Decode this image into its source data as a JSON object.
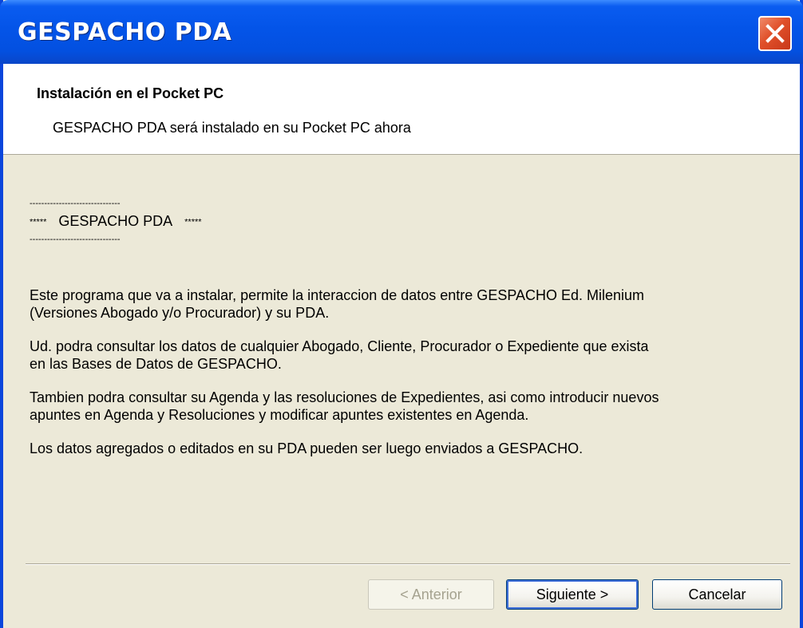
{
  "window": {
    "title": "GESPACHO PDA"
  },
  "header": {
    "title": "Instalación en el Pocket PC",
    "subtitle": "GESPACHO PDA será instalado en su Pocket PC ahora"
  },
  "content": {
    "dash_top": "-------------------------------",
    "banner_left_stars": "*****",
    "banner_text": "GESPACHO PDA",
    "banner_right_stars": "*****",
    "dash_bottom": "-------------------------------",
    "paragraph_1_line_1": "Este programa que va a instalar, permite la interaccion de datos entre GESPACHO Ed. Milenium",
    "paragraph_1_line_2": "(Versiones Abogado y/o Procurador) y su PDA.",
    "paragraph_2_line_1": "Ud. podra consultar los datos de cualquier Abogado, Cliente, Procurador o Expediente que exista",
    "paragraph_2_line_2": "en las Bases de Datos de GESPACHO.",
    "paragraph_3_line_1": "Tambien podra consultar su Agenda y las resoluciones de Expedientes, asi como introducir nuevos",
    "paragraph_3_line_2": "apuntes en Agenda y Resoluciones y modificar apuntes existentes en Agenda.",
    "paragraph_4_line_1": "Los datos agregados o editados en su PDA pueden ser luego enviados a GESPACHO."
  },
  "buttons": {
    "previous": "< Anterior",
    "next": "Siguiente >",
    "cancel": "Cancelar"
  },
  "colors": {
    "titlebar": "#0454e8",
    "window_bg": "#ece9d8",
    "close_button": "#e0502a"
  },
  "icons": {
    "close": "close-icon"
  }
}
